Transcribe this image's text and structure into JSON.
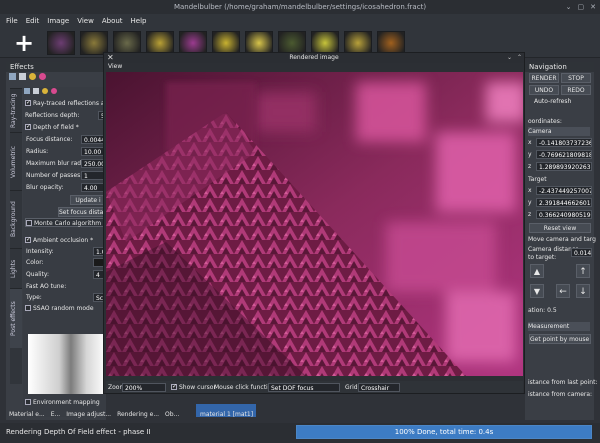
{
  "window": {
    "title": "Mandelbulber (/home/graham/mandelbulber/settings/icosahedron.fract)",
    "controls": [
      "⌄",
      "▢",
      "✕"
    ]
  },
  "menu": [
    "File",
    "Edit",
    "Image",
    "View",
    "About",
    "Help"
  ],
  "toolbar": {
    "add_label": "+"
  },
  "presets": [
    "#6c3d72",
    "#8a7a3a",
    "#6a6a4a",
    "#b9a035",
    "#9b3b8f",
    "#c9b230",
    "#d7c44a",
    "#4b5a30",
    "#c7c43a",
    "#b8a13a",
    "#a0601e"
  ],
  "effects": {
    "title": "Effects",
    "vertical_tabs": [
      "Ray-tracing",
      "Volumetric",
      "Background",
      "Lights",
      "Post effects"
    ],
    "raytraced_label": "Ray-traced reflections and tra",
    "reflections_depth_label": "Reflections depth:",
    "reflections_depth_value": "5",
    "dof_label": "Depth of field *",
    "focus_distance_label": "Focus distance:",
    "focus_distance_value": "0.00442",
    "radius_label": "Radius:",
    "radius_value": "10.00",
    "max_blur_label": "Maximum blur radius:",
    "max_blur_value": "250.00",
    "passes_label": "Number of passes:",
    "passes_value": "1",
    "blur_opacity_label": "Blur opacity:",
    "blur_opacity_value": "4.00",
    "update_label": "Update i",
    "set_focus_label": "Set focus distance",
    "monte_carlo_label": "Monte Carlo algorithm",
    "ao_label": "Ambient occlusion *",
    "intensity_label": "Intensity:",
    "intensity_value": "1.00",
    "color_label": "Color:",
    "quality_label": "Quality:",
    "quality_value": "4",
    "fast_ao_label": "Fast AO tune:",
    "type_label": "Type:",
    "type_value": "Scre",
    "ssao_label": "SSAO random mode",
    "env_mapping_label": "Environment mapping"
  },
  "render": {
    "title": "Rendered image",
    "view_menu": "View",
    "zoom_label": "Zoom:",
    "zoom_value": "200%",
    "show_cursor_label": "Show cursor",
    "mouse_click_label": "Mouse click function:",
    "mouse_click_value": "Set DOF focus",
    "grid_label": "Grid:",
    "grid_value": "Crosshair"
  },
  "navigation": {
    "title": "Navigation",
    "render_label": "RENDER",
    "stop_label": "STOP",
    "undo_label": "UNDO",
    "redo_label": "REDO",
    "autorefresh_label": "Auto-refresh",
    "coordinates_label": "oordinates:",
    "camera_label": "Camera",
    "cam_x": "-0.14180373723640",
    "cam_y": "-0.76962180981862",
    "cam_z": "1.28989392026376",
    "target_label": "Target",
    "tgt_x": "-2.43744925700775",
    "tgt_y": "2.39184466260181",
    "tgt_z": "0.36624098051969",
    "reset_view_label": "Reset view",
    "move_camera_label": "Move camera and targ",
    "camera_distance_label": "Camera distance",
    "to_target_label": "to target:",
    "distance_value": "0.014",
    "rotation_label": "ation: 0.5",
    "measurement_label": "Measurement",
    "get_point_label": "Get point by mouse poi",
    "distance_from_last_label": "istance from last point:",
    "distance_from_camera_label": "istance from camera:"
  },
  "bottom_tabs": [
    "Material e...",
    "E...",
    "Image adjust...",
    "Rendering e...",
    "Ob..."
  ],
  "material_label": "material 1 [mat1]",
  "status": {
    "message": "Rendering Depth Of Field effect - phase II",
    "progress_text": "100% Done, total time: 0.4s",
    "progress": 1.0
  }
}
